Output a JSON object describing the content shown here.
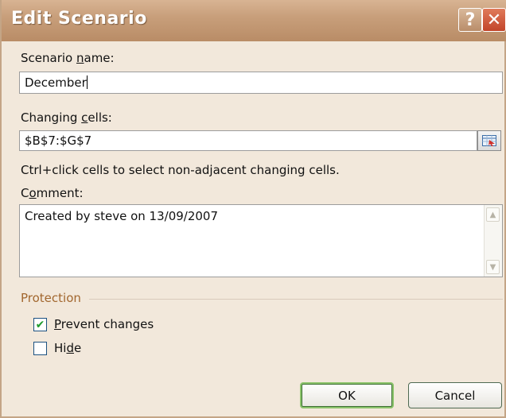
{
  "window": {
    "title": "Edit Scenario"
  },
  "titlebar": {
    "help_glyph": "?",
    "close_glyph": "✕",
    "help_icon": "help-icon",
    "close_icon": "close-icon"
  },
  "scenario_name": {
    "label_pre": "Scenario ",
    "label_u": "n",
    "label_post": "ame:",
    "value": "December"
  },
  "changing_cells": {
    "label_pre": "Changing ",
    "label_u": "c",
    "label_post": "ells:",
    "value": "$B$7:$G$7",
    "hint": "Ctrl+click cells to select non-adjacent changing cells.",
    "ref_icon": "collapse-dialog-icon"
  },
  "comment": {
    "label_pre": "C",
    "label_u": "o",
    "label_post": "mment:",
    "value": "Created by steve on 13/09/2007",
    "scroll_up": "▲",
    "scroll_down": "▼"
  },
  "protection": {
    "title": "Protection",
    "prevent": {
      "label_u": "P",
      "label_post": "revent changes",
      "checked": true,
      "check_glyph": "✔"
    },
    "hide": {
      "label_pre": "Hi",
      "label_u": "d",
      "label_post": "e",
      "checked": false
    }
  },
  "buttons": {
    "ok": "OK",
    "cancel": "Cancel"
  },
  "colors": {
    "titlebar": "#c89f7b",
    "dialog_bg": "#f2e8db",
    "section_title": "#a2672f",
    "check_green": "#1e9b2c"
  }
}
